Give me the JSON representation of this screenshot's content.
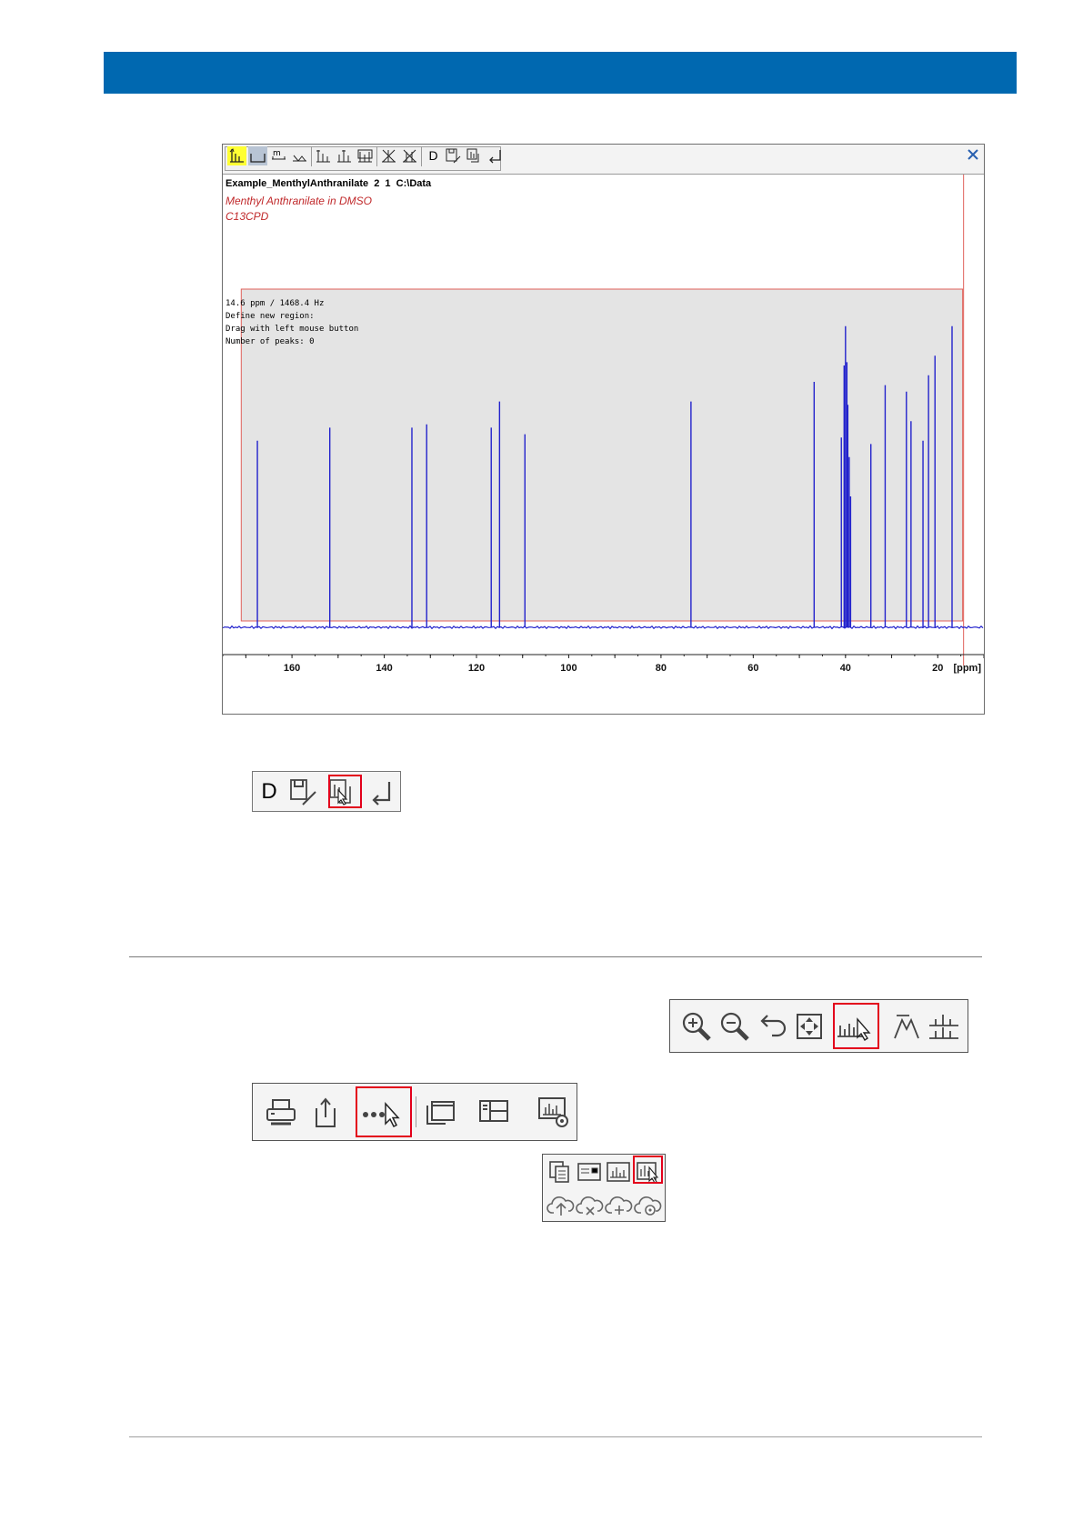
{
  "colors": {
    "header_bar": "#0068b0",
    "spectrum": "#2222cc",
    "region": "#e4e4e4",
    "region_border": "#e0605a",
    "annotation": "#c0282a",
    "highlight": "#e3001b",
    "tool_active": "#ffff33",
    "tool_pressed": "#b8c4d4"
  },
  "spectrum_window": {
    "title_line": "Example_MenthylAnthranilate  2  1  C:\\Data",
    "sample_line1": "Menthyl Anthranilate in DMSO",
    "sample_line2": "C13CPD",
    "info_lines": [
      "14.6 ppm / 1468.4 Hz",
      "Define new region:",
      "Drag with left mouse button",
      "Number of peaks: 0"
    ],
    "close_icon": "close-icon",
    "toolbar_icons": [
      "peak-pick-icon",
      "region-icon",
      "multiplet-icon",
      "integral-icon",
      "add-peak-icon",
      "pick-peak-icon",
      "pick-all-icon",
      "delete-peak-icon",
      "delete-all-icon"
    ],
    "toolbar_text_button": "D",
    "toolbar_icons_right": [
      "save-edit-icon",
      "export-region-icon",
      "return-icon"
    ],
    "axis_unit": "[ppm]"
  },
  "chart_data": {
    "type": "line",
    "title": "",
    "xlabel": "[ppm]",
    "ylabel": "",
    "xlim": [
      175,
      10
    ],
    "x_ticks": [
      160,
      140,
      120,
      100,
      80,
      60,
      40,
      20
    ],
    "region_ppm": [
      171,
      14.6
    ],
    "peaks": [
      {
        "ppm": 167.5,
        "height": 0.57
      },
      {
        "ppm": 151.8,
        "height": 0.61
      },
      {
        "ppm": 134.0,
        "height": 0.61
      },
      {
        "ppm": 130.8,
        "height": 0.62
      },
      {
        "ppm": 116.8,
        "height": 0.61
      },
      {
        "ppm": 115.0,
        "height": 0.69
      },
      {
        "ppm": 109.5,
        "height": 0.59
      },
      {
        "ppm": 73.5,
        "height": 0.69
      },
      {
        "ppm": 46.8,
        "height": 0.75
      },
      {
        "ppm": 40.9,
        "height": 0.58
      },
      {
        "ppm": 40.3,
        "height": 0.8
      },
      {
        "ppm": 40.0,
        "height": 0.92
      },
      {
        "ppm": 39.7,
        "height": 0.81
      },
      {
        "ppm": 39.5,
        "height": 0.68
      },
      {
        "ppm": 39.2,
        "height": 0.52
      },
      {
        "ppm": 38.9,
        "height": 0.4
      },
      {
        "ppm": 34.5,
        "height": 0.56
      },
      {
        "ppm": 31.4,
        "height": 0.74
      },
      {
        "ppm": 26.8,
        "height": 0.72
      },
      {
        "ppm": 25.8,
        "height": 0.63
      },
      {
        "ppm": 23.2,
        "height": 0.57
      },
      {
        "ppm": 22.0,
        "height": 0.77
      },
      {
        "ppm": 20.6,
        "height": 0.83
      },
      {
        "ppm": 16.9,
        "height": 0.92
      }
    ]
  },
  "small_toolbar": {
    "text_button": "D",
    "icons": [
      "save-edit-icon",
      "export-region-icon",
      "return-icon"
    ],
    "highlighted": "export-region-icon"
  },
  "nav_toolbar": {
    "icons": [
      "zoom-in-icon",
      "zoom-out-icon",
      "undo-icon",
      "fit-icon",
      "peak-picking-icon",
      "manual-peak-icon",
      "peak-list-icon"
    ],
    "highlighted": "peak-picking-icon"
  },
  "main_toolbar": {
    "icons": [
      "print-icon",
      "export-icon",
      "more-options-icon",
      "window-icon",
      "layout-icon",
      "spectrum-settings-icon"
    ],
    "highlighted": "more-options-icon"
  },
  "more_panel": {
    "icons": [
      "copy-icon",
      "preview-icon",
      "spectrum-icon",
      "peak-picking-icon",
      "cloud-upload-icon",
      "cloud-delete-icon",
      "cloud-add-icon",
      "cloud-settings-icon"
    ],
    "highlighted": "peak-picking-icon"
  }
}
